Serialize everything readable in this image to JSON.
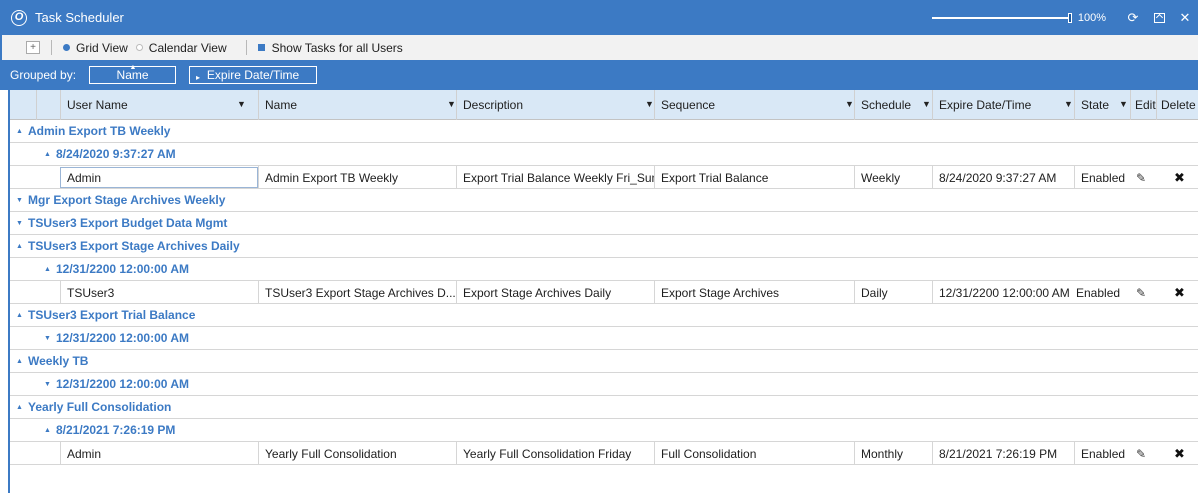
{
  "window": {
    "title": "Task Scheduler",
    "zoom": {
      "value_label": "100%",
      "level": 1.0
    }
  },
  "toolbar": {
    "expand_icon": "+",
    "grid_view_label": "Grid View",
    "calendar_view_label": "Calendar View",
    "show_tasks_label": "Show Tasks for all Users",
    "selected_view": "Grid View",
    "show_tasks_checked": true
  },
  "groupbar": {
    "label": "Grouped by:",
    "chips": [
      "Name",
      "Expire Date/Time"
    ]
  },
  "columns": {
    "user_name": "User Name",
    "name": "Name",
    "description": "Description",
    "sequence": "Sequence",
    "schedule": "Schedule",
    "expire": "Expire Date/Time",
    "state": "State",
    "edit": "Edit",
    "delete": "Delete"
  },
  "groups": {
    "g1": {
      "name": "Admin Export TB Weekly",
      "expanded": true,
      "sub": "8/24/2020 9:37:27 AM",
      "row": {
        "user": "Admin",
        "name": "Admin Export TB Weekly",
        "description": "Export Trial Balance Weekly Fri_Sun",
        "sequence": "Export Trial Balance",
        "schedule": "Weekly",
        "expire": "8/24/2020 9:37:27 AM",
        "state": "Enabled"
      }
    },
    "g2": {
      "name": "Mgr Export Stage Archives Weekly",
      "expanded": false
    },
    "g3": {
      "name": "TSUser3 Export Budget Data Mgmt",
      "expanded": false
    },
    "g4": {
      "name": "TSUser3 Export Stage Archives Daily",
      "expanded": true,
      "sub": "12/31/2200 12:00:00 AM",
      "row": {
        "user": "TSUser3",
        "name": "TSUser3 Export Stage Archives D...",
        "description": "Export Stage Archives Daily",
        "sequence": "Export Stage Archives",
        "schedule": "Daily",
        "expire": "12/31/2200 12:00:00 AM",
        "state": "Enabled"
      }
    },
    "g5": {
      "name": "TSUser3 Export Trial Balance",
      "expanded": true,
      "sub": "12/31/2200 12:00:00 AM",
      "sub_expanded": false
    },
    "g6": {
      "name": "Weekly TB",
      "expanded": true,
      "sub": "12/31/2200 12:00:00 AM",
      "sub_expanded": false
    },
    "g7": {
      "name": "Yearly Full Consolidation",
      "expanded": true,
      "sub": "8/21/2021 7:26:19 PM",
      "row": {
        "user": "Admin",
        "name": "Yearly Full Consolidation",
        "description": "Yearly Full Consolidation Friday",
        "sequence": "Full Consolidation",
        "schedule": "Monthly",
        "expire": "8/21/2021 7:26:19 PM",
        "state": "Enabled"
      }
    }
  },
  "icons": {
    "expanded": "▲",
    "collapsed": "▼",
    "filter": "▼",
    "edit": "✎",
    "delete": "✖",
    "refresh": "⟳",
    "close": "✕"
  },
  "colors": {
    "accent": "#3c7ac4",
    "header_bg": "#d9e8f6",
    "group_text": "#3c7ac4"
  }
}
